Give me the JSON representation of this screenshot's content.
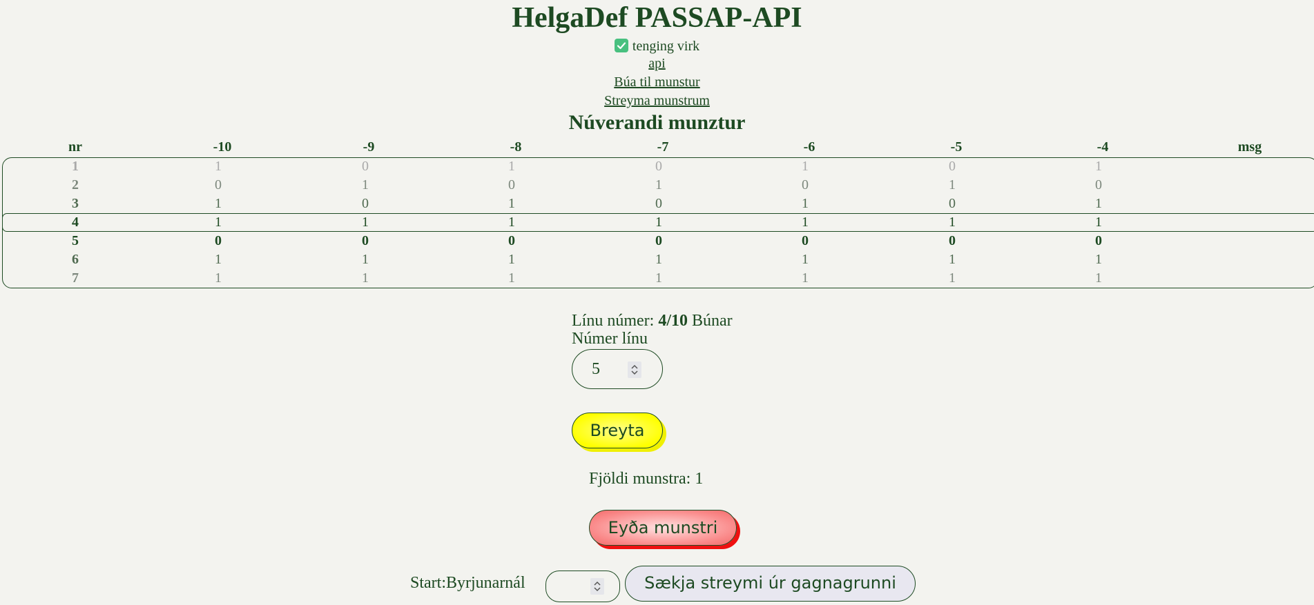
{
  "header": {
    "title": "HelgaDef PASSAP-API",
    "connection_status": "tenging virk",
    "links": [
      "api",
      "Búa til munstur",
      "Streyma munstrum"
    ],
    "section_title": "Núverandi munztur"
  },
  "pattern_table": {
    "columns": [
      "nr",
      "-10",
      "-9",
      "-8",
      "-7",
      "-6",
      "-5",
      "-4",
      "msg"
    ],
    "rows": [
      {
        "nr": "1",
        "cells": [
          "1",
          "0",
          "1",
          "0",
          "1",
          "0",
          "1"
        ],
        "msg": ""
      },
      {
        "nr": "2",
        "cells": [
          "0",
          "1",
          "0",
          "1",
          "0",
          "1",
          "0"
        ],
        "msg": ""
      },
      {
        "nr": "3",
        "cells": [
          "1",
          "0",
          "1",
          "0",
          "1",
          "0",
          "1"
        ],
        "msg": ""
      },
      {
        "nr": "4",
        "cells": [
          "1",
          "1",
          "1",
          "1",
          "1",
          "1",
          "1"
        ],
        "msg": ""
      },
      {
        "nr": "5",
        "cells": [
          "0",
          "0",
          "0",
          "0",
          "0",
          "0",
          "0"
        ],
        "msg": ""
      },
      {
        "nr": "6",
        "cells": [
          "1",
          "1",
          "1",
          "1",
          "1",
          "1",
          "1"
        ],
        "msg": ""
      },
      {
        "nr": "7",
        "cells": [
          "1",
          "1",
          "1",
          "1",
          "1",
          "1",
          "1"
        ],
        "msg": ""
      }
    ],
    "active_row": "4"
  },
  "controls": {
    "line_label": "Línu númer:",
    "line_value": "4/10",
    "line_status": "Búnar",
    "line_number_label": "Númer línu",
    "line_number_value": "5",
    "change_button": "Breyta",
    "pattern_count_label": "Fjöldi munstra:",
    "pattern_count_value": "1",
    "delete_button": "Eyða munstri",
    "start_label": "Start:Byrjunarnál",
    "start_value": "",
    "fetch_button": "Sækja streymi úr gagnagrunni"
  },
  "colors": {
    "text": "#1d4a22",
    "background": "#f3f3ef",
    "change_button": "#ffff00",
    "delete_button": "#fa8a8a",
    "checkbox": "#48c07f"
  }
}
